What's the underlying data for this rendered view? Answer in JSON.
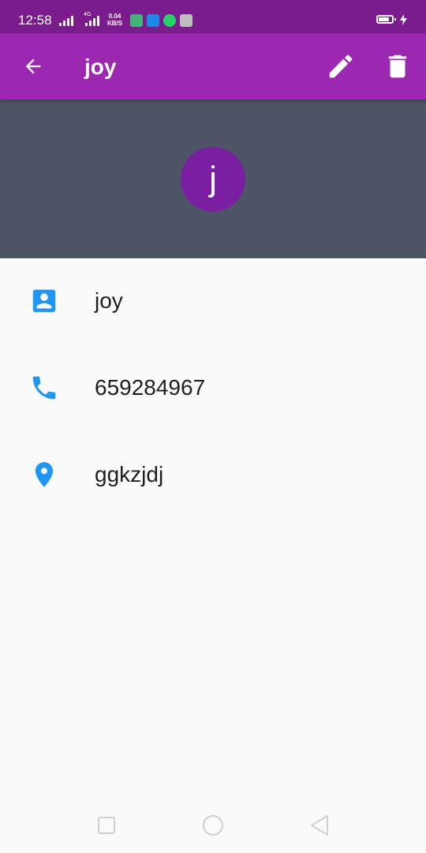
{
  "status_bar": {
    "time": "12:58",
    "network_label": "4G",
    "speed_value": "0.04",
    "speed_unit": "KB/S"
  },
  "app_bar": {
    "title": "joy",
    "back_icon": "arrow-back-icon",
    "edit_icon": "pencil-icon",
    "delete_icon": "trash-icon"
  },
  "contact": {
    "avatar_letter": "j",
    "name": "joy",
    "phone": "659284967",
    "address": "ggkzjdj"
  },
  "colors": {
    "status_bar": "#7b1c8c",
    "app_bar": "#9c27b0",
    "header_bg": "#4d5465",
    "avatar_bg": "#7b1fa2",
    "icon_blue": "#2196f3"
  },
  "nav_bar": {
    "recents_icon": "square-icon",
    "home_icon": "circle-icon",
    "back_icon": "triangle-back-icon"
  }
}
